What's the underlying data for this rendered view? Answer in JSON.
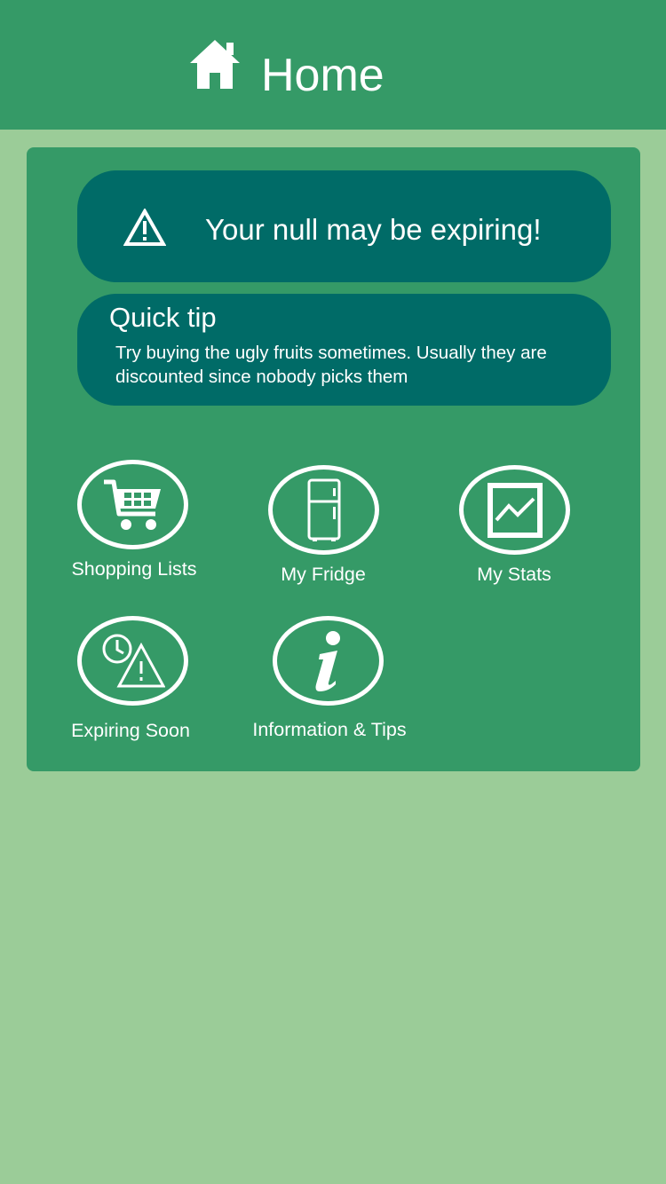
{
  "header": {
    "title": "Home",
    "icon": "home-icon"
  },
  "alert": {
    "icon": "warning-icon",
    "text": "Your null may be expiring!"
  },
  "tip": {
    "title": "Quick tip",
    "body": "Try buying the ugly fruits sometimes. Usually they are discounted since nobody picks them"
  },
  "tiles": [
    {
      "label": "Shopping Lists",
      "icon": "shopping-cart-icon"
    },
    {
      "label": "My Fridge",
      "icon": "fridge-icon"
    },
    {
      "label": "My Stats",
      "icon": "stats-chart-icon"
    },
    {
      "label": "Expiring Soon",
      "icon": "clock-warning-icon"
    },
    {
      "label": "Information & Tips",
      "icon": "info-icon"
    }
  ],
  "colors": {
    "background": "#9bcc98",
    "header": "#359a67",
    "panel": "#359a67",
    "card": "#006b67",
    "text": "#ffffff"
  }
}
